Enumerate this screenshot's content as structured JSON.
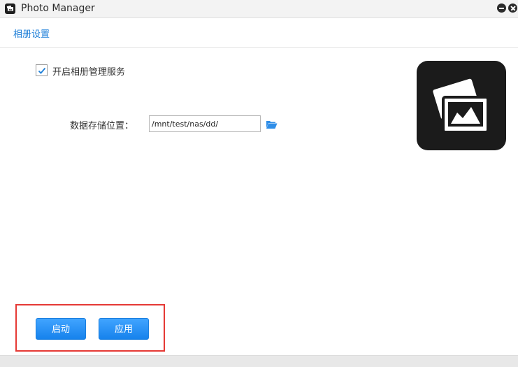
{
  "window": {
    "title": "Photo Manager",
    "app_icon": "photo-app-icon",
    "minimize_icon": "minimize-icon",
    "close_icon": "close-icon"
  },
  "tabs": [
    {
      "label": "相册设置",
      "active": true
    }
  ],
  "settings": {
    "enable_service_label": "开启相册管理服务",
    "enable_service_checked": true,
    "storage_label": "数据存储位置：",
    "storage_path": "/mnt/test/nas/dd/",
    "browse_icon": "folder-open-icon"
  },
  "logo_icon": "photos-icon",
  "buttons": {
    "start_label": "启动",
    "apply_label": "应用"
  },
  "colors": {
    "accent": "#1e7fd8",
    "button": "#1682ec",
    "highlight": "#e53935",
    "logo_bg": "#1b1b1b"
  }
}
